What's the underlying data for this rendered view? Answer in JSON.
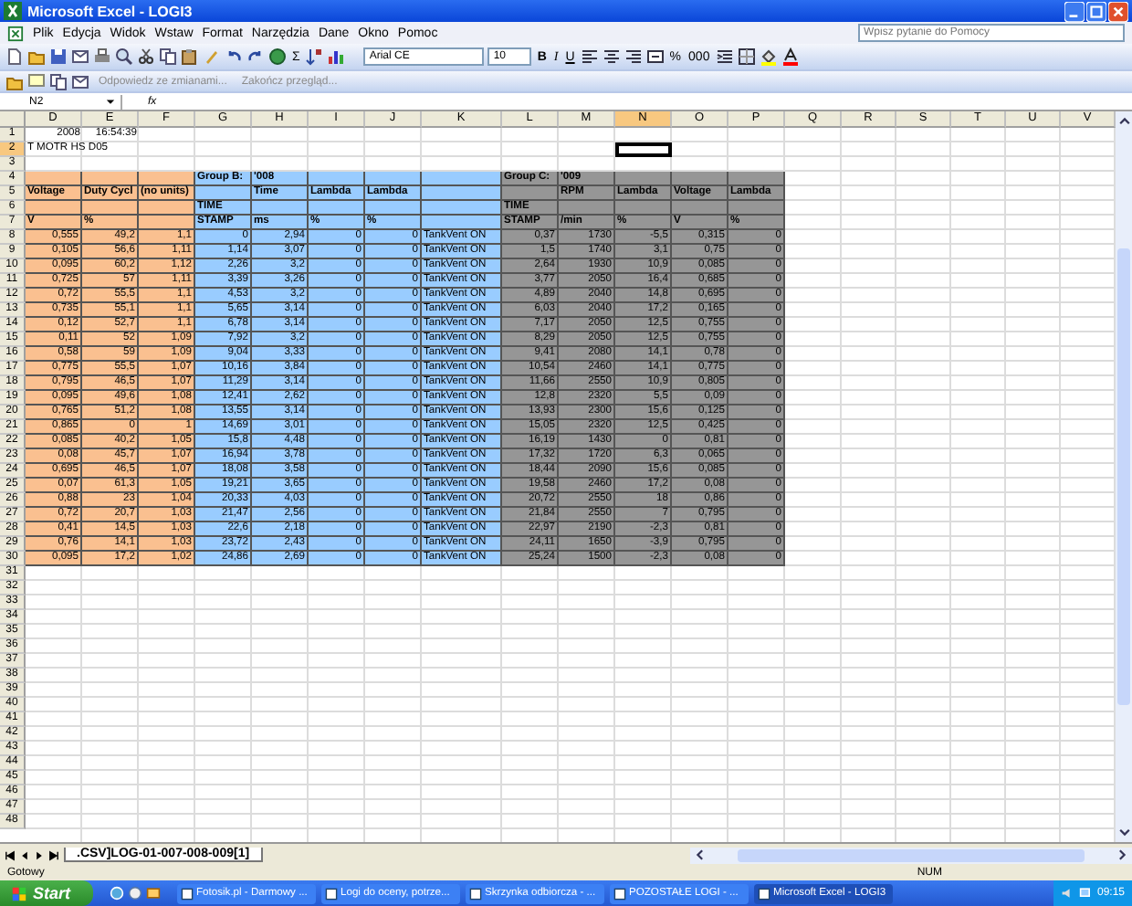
{
  "window": {
    "title": "Microsoft Excel - LOGI3"
  },
  "menu": [
    "Plik",
    "Edycja",
    "Widok",
    "Wstaw",
    "Format",
    "Narzędzia",
    "Dane",
    "Okno",
    "Pomoc"
  ],
  "help_field": {
    "placeholder": "Wpisz pytanie do Pomocy"
  },
  "toolbar": {
    "sum": "Σ",
    "font": "Arial CE",
    "size": "10",
    "format_buttons": [
      "B",
      "I",
      "U"
    ],
    "number_buttons": [
      "%",
      "000"
    ]
  },
  "review_toolbar": [
    {
      "label": "Odpowiedz ze zmianami...",
      "disabled": true
    },
    {
      "label": "Zakończ przegląd...",
      "disabled": true
    }
  ],
  "formula_bar": {
    "name_box": "N2",
    "fx": "fx"
  },
  "columns": [
    {
      "label": "D",
      "selected": false,
      "kind": "number",
      "color": "#fac090"
    },
    {
      "label": "E",
      "selected": false,
      "kind": "number",
      "color": "#fac090"
    },
    {
      "label": "F",
      "selected": false,
      "kind": "number",
      "color": "#fac090"
    },
    {
      "label": "G",
      "selected": false,
      "kind": "number",
      "color": "#99ccff"
    },
    {
      "label": "H",
      "selected": false,
      "kind": "number",
      "color": "#99ccff"
    },
    {
      "label": "I",
      "selected": false,
      "kind": "number",
      "color": "#99ccff"
    },
    {
      "label": "J",
      "selected": false,
      "kind": "number",
      "color": "#99ccff"
    },
    {
      "label": "K",
      "selected": false,
      "kind": "text",
      "color": "#99ccff"
    },
    {
      "label": "L",
      "selected": false,
      "kind": "number",
      "color": "#969696"
    },
    {
      "label": "M",
      "selected": false,
      "kind": "number",
      "color": "#969696"
    },
    {
      "label": "N",
      "selected": true,
      "kind": "number",
      "color": "#969696"
    },
    {
      "label": "O",
      "selected": false,
      "kind": "number",
      "color": "#969696"
    },
    {
      "label": "P",
      "selected": false,
      "kind": "number",
      "color": "#969696"
    },
    {
      "label": "Q",
      "selected": false,
      "kind": "number"
    },
    {
      "label": "R",
      "selected": false,
      "kind": "number"
    },
    {
      "label": "S",
      "selected": false,
      "kind": "number"
    },
    {
      "label": "T",
      "selected": false,
      "kind": "number"
    },
    {
      "label": "U",
      "selected": false,
      "kind": "number"
    },
    {
      "label": "V",
      "selected": false,
      "kind": "number"
    }
  ],
  "rows": [
    {
      "number": "1",
      "kind": "plain",
      "selected": false,
      "banded": false,
      "cells": {
        "D": "2008",
        "E": "16:54:39"
      }
    },
    {
      "number": "2",
      "kind": "title",
      "selected": true,
      "banded": false,
      "cells": {
        "D": "T MOTR HS D05"
      }
    },
    {
      "number": "3",
      "kind": "plain",
      "selected": false,
      "banded": false,
      "cells": {}
    },
    {
      "number": "4",
      "kind": "header",
      "selected": false,
      "banded": true,
      "cells": {
        "G": "Group B:",
        "H": "'008",
        "L": "Group C:",
        "M": "'009"
      }
    },
    {
      "number": "5",
      "kind": "header",
      "selected": false,
      "banded": true,
      "cells": {
        "D": "Voltage",
        "E": "Duty Cycl",
        "F": "(no units)",
        "H": "Time",
        "I": "Lambda",
        "J": "Lambda",
        "M": "RPM",
        "N": "Lambda",
        "O": "Voltage",
        "P": "Lambda"
      }
    },
    {
      "number": "6",
      "kind": "header",
      "selected": false,
      "banded": true,
      "cells": {
        "G": "TIME",
        "L": "TIME"
      }
    },
    {
      "number": "7",
      "kind": "header",
      "selected": false,
      "banded": true,
      "cells": {
        "D": "V",
        "E": "%",
        "G": "STAMP",
        "H": "ms",
        "I": "%",
        "J": "%",
        "L": "STAMP",
        "M": "/min",
        "N": "%",
        "O": "V",
        "P": "%"
      }
    },
    {
      "number": "8",
      "kind": "plain",
      "selected": false,
      "banded": true,
      "cells": {
        "D": "0,555",
        "E": "49,2",
        "F": "1,1",
        "G": "0",
        "H": "2,94",
        "I": "0",
        "J": "0",
        "K": "TankVent ON",
        "L": "0,37",
        "M": "1730",
        "N": "-5,5",
        "O": "0,315",
        "P": "0"
      }
    },
    {
      "number": "9",
      "kind": "plain",
      "selected": false,
      "banded": true,
      "cells": {
        "D": "0,105",
        "E": "56,6",
        "F": "1,11",
        "G": "1,14",
        "H": "3,07",
        "I": "0",
        "J": "0",
        "K": "TankVent ON",
        "L": "1,5",
        "M": "1740",
        "N": "3,1",
        "O": "0,75",
        "P": "0"
      }
    },
    {
      "number": "10",
      "kind": "plain",
      "selected": false,
      "banded": true,
      "cells": {
        "D": "0,095",
        "E": "60,2",
        "F": "1,12",
        "G": "2,26",
        "H": "3,2",
        "I": "0",
        "J": "0",
        "K": "TankVent ON",
        "L": "2,64",
        "M": "1930",
        "N": "10,9",
        "O": "0,085",
        "P": "0"
      }
    },
    {
      "number": "11",
      "kind": "plain",
      "selected": false,
      "banded": true,
      "cells": {
        "D": "0,725",
        "E": "57",
        "F": "1,11",
        "G": "3,39",
        "H": "3,26",
        "I": "0",
        "J": "0",
        "K": "TankVent ON",
        "L": "3,77",
        "M": "2050",
        "N": "16,4",
        "O": "0,685",
        "P": "0"
      }
    },
    {
      "number": "12",
      "kind": "plain",
      "selected": false,
      "banded": true,
      "cells": {
        "D": "0,72",
        "E": "55,5",
        "F": "1,1",
        "G": "4,53",
        "H": "3,2",
        "I": "0",
        "J": "0",
        "K": "TankVent ON",
        "L": "4,89",
        "M": "2040",
        "N": "14,8",
        "O": "0,695",
        "P": "0"
      }
    },
    {
      "number": "13",
      "kind": "plain",
      "selected": false,
      "banded": true,
      "cells": {
        "D": "0,735",
        "E": "55,1",
        "F": "1,1",
        "G": "5,65",
        "H": "3,14",
        "I": "0",
        "J": "0",
        "K": "TankVent ON",
        "L": "6,03",
        "M": "2040",
        "N": "17,2",
        "O": "0,165",
        "P": "0"
      }
    },
    {
      "number": "14",
      "kind": "plain",
      "selected": false,
      "banded": true,
      "cells": {
        "D": "0,12",
        "E": "52,7",
        "F": "1,1",
        "G": "6,78",
        "H": "3,14",
        "I": "0",
        "J": "0",
        "K": "TankVent ON",
        "L": "7,17",
        "M": "2050",
        "N": "12,5",
        "O": "0,755",
        "P": "0"
      }
    },
    {
      "number": "15",
      "kind": "plain",
      "selected": false,
      "banded": true,
      "cells": {
        "D": "0,11",
        "E": "52",
        "F": "1,09",
        "G": "7,92",
        "H": "3,2",
        "I": "0",
        "J": "0",
        "K": "TankVent ON",
        "L": "8,29",
        "M": "2050",
        "N": "12,5",
        "O": "0,755",
        "P": "0"
      }
    },
    {
      "number": "16",
      "kind": "plain",
      "selected": false,
      "banded": true,
      "cells": {
        "D": "0,58",
        "E": "59",
        "F": "1,09",
        "G": "9,04",
        "H": "3,33",
        "I": "0",
        "J": "0",
        "K": "TankVent ON",
        "L": "9,41",
        "M": "2080",
        "N": "14,1",
        "O": "0,78",
        "P": "0"
      }
    },
    {
      "number": "17",
      "kind": "plain",
      "selected": false,
      "banded": true,
      "cells": {
        "D": "0,775",
        "E": "55,5",
        "F": "1,07",
        "G": "10,16",
        "H": "3,84",
        "I": "0",
        "J": "0",
        "K": "TankVent ON",
        "L": "10,54",
        "M": "2460",
        "N": "14,1",
        "O": "0,775",
        "P": "0"
      }
    },
    {
      "number": "18",
      "kind": "plain",
      "selected": false,
      "banded": true,
      "cells": {
        "D": "0,795",
        "E": "46,5",
        "F": "1,07",
        "G": "11,29",
        "H": "3,14",
        "I": "0",
        "J": "0",
        "K": "TankVent ON",
        "L": "11,66",
        "M": "2550",
        "N": "10,9",
        "O": "0,805",
        "P": "0"
      }
    },
    {
      "number": "19",
      "kind": "plain",
      "selected": false,
      "banded": true,
      "cells": {
        "D": "0,095",
        "E": "49,6",
        "F": "1,08",
        "G": "12,41",
        "H": "2,62",
        "I": "0",
        "J": "0",
        "K": "TankVent ON",
        "L": "12,8",
        "M": "2320",
        "N": "5,5",
        "O": "0,09",
        "P": "0"
      }
    },
    {
      "number": "20",
      "kind": "plain",
      "selected": false,
      "banded": true,
      "cells": {
        "D": "0,765",
        "E": "51,2",
        "F": "1,08",
        "G": "13,55",
        "H": "3,14",
        "I": "0",
        "J": "0",
        "K": "TankVent ON",
        "L": "13,93",
        "M": "2300",
        "N": "15,6",
        "O": "0,125",
        "P": "0"
      }
    },
    {
      "number": "21",
      "kind": "plain",
      "selected": false,
      "banded": true,
      "cells": {
        "D": "0,865",
        "E": "0",
        "F": "1",
        "G": "14,69",
        "H": "3,01",
        "I": "0",
        "J": "0",
        "K": "TankVent ON",
        "L": "15,05",
        "M": "2320",
        "N": "12,5",
        "O": "0,425",
        "P": "0"
      }
    },
    {
      "number": "22",
      "kind": "plain",
      "selected": false,
      "banded": true,
      "cells": {
        "D": "0,085",
        "E": "40,2",
        "F": "1,05",
        "G": "15,8",
        "H": "4,48",
        "I": "0",
        "J": "0",
        "K": "TankVent ON",
        "L": "16,19",
        "M": "1430",
        "N": "0",
        "O": "0,81",
        "P": "0"
      }
    },
    {
      "number": "23",
      "kind": "plain",
      "selected": false,
      "banded": true,
      "cells": {
        "D": "0,08",
        "E": "45,7",
        "F": "1,07",
        "G": "16,94",
        "H": "3,78",
        "I": "0",
        "J": "0",
        "K": "TankVent ON",
        "L": "17,32",
        "M": "1720",
        "N": "6,3",
        "O": "0,065",
        "P": "0"
      }
    },
    {
      "number": "24",
      "kind": "plain",
      "selected": false,
      "banded": true,
      "cells": {
        "D": "0,695",
        "E": "46,5",
        "F": "1,07",
        "G": "18,08",
        "H": "3,58",
        "I": "0",
        "J": "0",
        "K": "TankVent ON",
        "L": "18,44",
        "M": "2090",
        "N": "15,6",
        "O": "0,085",
        "P": "0"
      }
    },
    {
      "number": "25",
      "kind": "plain",
      "selected": false,
      "banded": true,
      "cells": {
        "D": "0,07",
        "E": "61,3",
        "F": "1,05",
        "G": "19,21",
        "H": "3,65",
        "I": "0",
        "J": "0",
        "K": "TankVent ON",
        "L": "19,58",
        "M": "2460",
        "N": "17,2",
        "O": "0,08",
        "P": "0"
      }
    },
    {
      "number": "26",
      "kind": "plain",
      "selected": false,
      "banded": true,
      "cells": {
        "D": "0,88",
        "E": "23",
        "F": "1,04",
        "G": "20,33",
        "H": "4,03",
        "I": "0",
        "J": "0",
        "K": "TankVent ON",
        "L": "20,72",
        "M": "2550",
        "N": "18",
        "O": "0,86",
        "P": "0"
      }
    },
    {
      "number": "27",
      "kind": "plain",
      "selected": false,
      "banded": true,
      "cells": {
        "D": "0,72",
        "E": "20,7",
        "F": "1,03",
        "G": "21,47",
        "H": "2,56",
        "I": "0",
        "J": "0",
        "K": "TankVent ON",
        "L": "21,84",
        "M": "2550",
        "N": "7",
        "O": "0,795",
        "P": "0"
      }
    },
    {
      "number": "28",
      "kind": "plain",
      "selected": false,
      "banded": true,
      "cells": {
        "D": "0,41",
        "E": "14,5",
        "F": "1,03",
        "G": "22,6",
        "H": "2,18",
        "I": "0",
        "J": "0",
        "K": "TankVent ON",
        "L": "22,97",
        "M": "2190",
        "N": "-2,3",
        "O": "0,81",
        "P": "0"
      }
    },
    {
      "number": "29",
      "kind": "plain",
      "selected": false,
      "banded": true,
      "cells": {
        "D": "0,76",
        "E": "14,1",
        "F": "1,03",
        "G": "23,72",
        "H": "2,43",
        "I": "0",
        "J": "0",
        "K": "TankVent ON",
        "L": "24,11",
        "M": "1650",
        "N": "-3,9",
        "O": "0,795",
        "P": "0"
      }
    },
    {
      "number": "30",
      "kind": "plain",
      "selected": false,
      "banded": true,
      "cells": {
        "D": "0,095",
        "E": "17,2",
        "F": "1,02",
        "G": "24,86",
        "H": "2,69",
        "I": "0",
        "J": "0",
        "K": "TankVent ON",
        "L": "25,24",
        "M": "1500",
        "N": "-2,3",
        "O": "0,08",
        "P": "0"
      }
    },
    {
      "number": "31",
      "kind": "plain",
      "selected": false,
      "banded": false,
      "cells": {}
    },
    {
      "number": "32",
      "kind": "plain",
      "selected": false,
      "banded": false,
      "cells": {}
    },
    {
      "number": "33",
      "kind": "plain",
      "selected": false,
      "banded": false,
      "cells": {}
    },
    {
      "number": "34",
      "kind": "plain",
      "selected": false,
      "banded": false,
      "cells": {}
    },
    {
      "number": "35",
      "kind": "plain",
      "selected": false,
      "banded": false,
      "cells": {}
    },
    {
      "number": "36",
      "kind": "plain",
      "selected": false,
      "banded": false,
      "cells": {}
    },
    {
      "number": "37",
      "kind": "plain",
      "selected": false,
      "banded": false,
      "cells": {}
    },
    {
      "number": "38",
      "kind": "plain",
      "selected": false,
      "banded": false,
      "cells": {}
    },
    {
      "number": "39",
      "kind": "plain",
      "selected": false,
      "banded": false,
      "cells": {}
    },
    {
      "number": "40",
      "kind": "plain",
      "selected": false,
      "banded": false,
      "cells": {}
    },
    {
      "number": "41",
      "kind": "plain",
      "selected": false,
      "banded": false,
      "cells": {}
    },
    {
      "number": "42",
      "kind": "plain",
      "selected": false,
      "banded": false,
      "cells": {}
    },
    {
      "number": "43",
      "kind": "plain",
      "selected": false,
      "banded": false,
      "cells": {}
    },
    {
      "number": "44",
      "kind": "plain",
      "selected": false,
      "banded": false,
      "cells": {}
    },
    {
      "number": "45",
      "kind": "plain",
      "selected": false,
      "banded": false,
      "cells": {}
    },
    {
      "number": "46",
      "kind": "plain",
      "selected": false,
      "banded": false,
      "cells": {}
    },
    {
      "number": "47",
      "kind": "plain",
      "selected": false,
      "banded": false,
      "cells": {}
    },
    {
      "number": "48",
      "kind": "plain",
      "selected": false,
      "banded": false,
      "cells": {}
    }
  ],
  "sheet_tabs": [
    {
      "label": ".CSV]LOG-01-007-008-009[1]",
      "selected": true
    }
  ],
  "status_bar": {
    "text": "Gotowy",
    "indicator": "NUM"
  },
  "taskbar": {
    "start": "Start",
    "tasks": [
      {
        "label": "Fotosik.pl - Darmowy ...",
        "selected": false
      },
      {
        "label": "Logi do oceny, potrze...",
        "selected": false
      },
      {
        "label": "Skrzynka odbiorcza - ...",
        "selected": false
      },
      {
        "label": "POZOSTAŁE LOGI - ...",
        "selected": false
      },
      {
        "label": "Microsoft Excel - LOGI3",
        "selected": true
      }
    ],
    "clock": "09:15"
  }
}
